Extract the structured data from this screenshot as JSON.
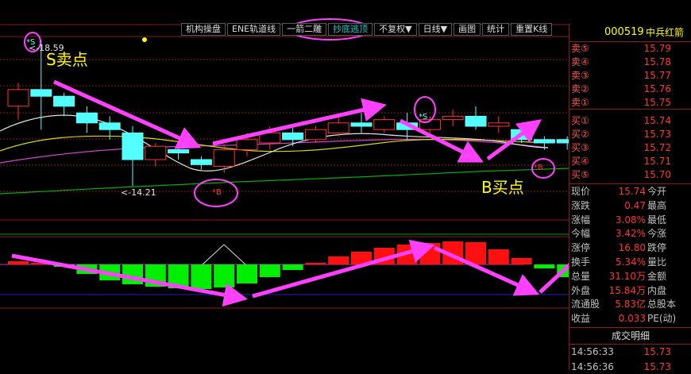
{
  "toolbar": {
    "items": [
      "机构操盘",
      "ENE轨道线",
      "一箭二雕",
      "抄底逃顶",
      "不复权▼",
      "日线▼",
      "画图",
      "统计",
      "重置K线"
    ],
    "active_index": 3
  },
  "annotations": {
    "s_sell_label": "S卖点",
    "b_buy_label": "B买点",
    "high_value": "<-18.59",
    "low_value": "<-14.21",
    "s_marker": "*S",
    "b_marker": "*B"
  },
  "stock": {
    "code": "000519",
    "name": "中兵红箭"
  },
  "order_book": {
    "asks": [
      {
        "label": "卖⑤",
        "price": "15.79"
      },
      {
        "label": "卖④",
        "price": "15.78"
      },
      {
        "label": "卖③",
        "price": "15.77"
      },
      {
        "label": "卖②",
        "price": "15.76"
      },
      {
        "label": "卖①",
        "price": "15.75"
      }
    ],
    "bids": [
      {
        "label": "买①",
        "price": "15.74"
      },
      {
        "label": "买②",
        "price": "15.73"
      },
      {
        "label": "买③",
        "price": "15.72"
      },
      {
        "label": "买④",
        "price": "15.71"
      },
      {
        "label": "买⑤",
        "price": "15.70"
      }
    ]
  },
  "quote": {
    "rows": [
      {
        "l": "现价",
        "v": "15.74",
        "r": "今开"
      },
      {
        "l": "涨跌",
        "v": "0.47",
        "r": "最高"
      },
      {
        "l": "涨幅",
        "v": "3.08%",
        "r": "最低"
      },
      {
        "l": "今幅",
        "v": "3.42%",
        "r": "今涨"
      },
      {
        "l": "涨停",
        "v": "16.80",
        "r": "跌停"
      },
      {
        "l": "换手",
        "v": "5.34%",
        "r": "量比"
      },
      {
        "l": "总量",
        "v": "31.10万",
        "r": "金额"
      },
      {
        "l": "外盘",
        "v": "15.84万",
        "r": "内盘"
      },
      {
        "l": "流通股",
        "v": "5.83亿",
        "r": "总股本"
      },
      {
        "l": "收益",
        "v": "0.033",
        "r": "PE(动)"
      }
    ]
  },
  "trades": {
    "title": "成交明细",
    "rows": [
      {
        "time": "14:56:33",
        "price": "15.73"
      },
      {
        "time": "14:56:36",
        "price": "15.73"
      }
    ]
  },
  "colors": {
    "up": "#ff3232",
    "down": "#54ffff",
    "arrow": "#ff40ff",
    "annotation": "#ffff00",
    "grid": "#8a1a1a"
  },
  "candles": [
    {
      "o": 16.6,
      "c": 17.1,
      "h": 17.3,
      "l": 16.2
    },
    {
      "o": 17.1,
      "c": 16.9,
      "h": 18.59,
      "l": 15.9
    },
    {
      "o": 16.9,
      "c": 16.6,
      "h": 17.0,
      "l": 16.3
    },
    {
      "o": 16.4,
      "c": 16.1,
      "h": 16.6,
      "l": 15.8
    },
    {
      "o": 16.1,
      "c": 15.9,
      "h": 16.3,
      "l": 15.6
    },
    {
      "o": 15.8,
      "c": 15.0,
      "h": 16.0,
      "l": 14.21
    },
    {
      "o": 15.0,
      "c": 15.4,
      "h": 15.5,
      "l": 14.8
    },
    {
      "o": 15.3,
      "c": 15.2,
      "h": 15.45,
      "l": 15.0
    },
    {
      "o": 15.0,
      "c": 14.85,
      "h": 15.1,
      "l": 14.7
    },
    {
      "o": 14.8,
      "c": 15.3,
      "h": 15.45,
      "l": 14.6
    },
    {
      "o": 15.3,
      "c": 15.6,
      "h": 15.8,
      "l": 15.1
    },
    {
      "o": 15.5,
      "c": 15.8,
      "h": 16.0,
      "l": 15.3
    },
    {
      "o": 15.8,
      "c": 15.6,
      "h": 15.95,
      "l": 15.4
    },
    {
      "o": 15.6,
      "c": 15.9,
      "h": 16.0,
      "l": 15.5
    },
    {
      "o": 15.8,
      "c": 16.1,
      "h": 16.3,
      "l": 15.7
    },
    {
      "o": 16.1,
      "c": 16.0,
      "h": 16.4,
      "l": 15.8
    },
    {
      "o": 15.9,
      "c": 16.2,
      "h": 16.3,
      "l": 15.8
    },
    {
      "o": 16.1,
      "c": 15.9,
      "h": 16.4,
      "l": 15.6
    },
    {
      "o": 15.9,
      "c": 16.2,
      "h": 16.3,
      "l": 15.8
    },
    {
      "o": 16.2,
      "c": 16.3,
      "h": 16.5,
      "l": 16.0
    },
    {
      "o": 16.3,
      "c": 16.0,
      "h": 16.6,
      "l": 15.9
    },
    {
      "o": 16.0,
      "c": 16.1,
      "h": 16.3,
      "l": 15.8
    },
    {
      "o": 15.9,
      "c": 15.6,
      "h": 16.1,
      "l": 15.5
    },
    {
      "o": 15.6,
      "c": 15.5,
      "h": 15.7,
      "l": 15.3
    },
    {
      "o": 15.6,
      "c": 15.5,
      "h": 15.7,
      "l": 15.3
    },
    {
      "o": 15.5,
      "c": 15.74,
      "h": 15.9,
      "l": 15.4
    }
  ],
  "indicator": {
    "values": [
      0.4,
      0.2,
      -0.3,
      -1.2,
      -2.0,
      -2.5,
      -2.8,
      -3.0,
      -3.1,
      -2.9,
      -2.4,
      -1.6,
      -0.7,
      0.2,
      1.0,
      1.6,
      2.1,
      2.5,
      2.7,
      2.9,
      2.8,
      1.9,
      0.8,
      -0.5,
      -1.6,
      -2.2
    ]
  }
}
